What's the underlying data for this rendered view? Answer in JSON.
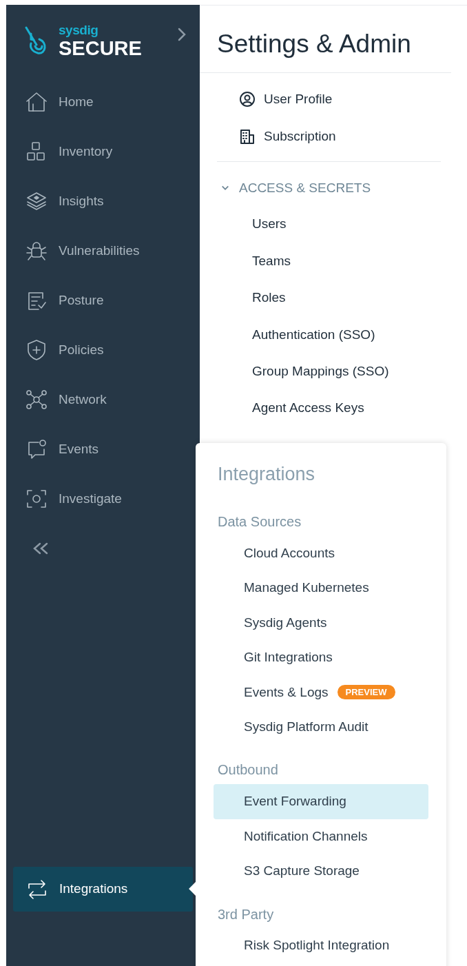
{
  "sidebar": {
    "logo": {
      "brand": "sysdig",
      "product": "SECURE"
    },
    "items": [
      {
        "label": "Home",
        "selected": false
      },
      {
        "label": "Inventory",
        "selected": false
      },
      {
        "label": "Insights",
        "selected": false
      },
      {
        "label": "Vulnerabilities",
        "selected": false
      },
      {
        "label": "Posture",
        "selected": false
      },
      {
        "label": "Policies",
        "selected": false
      },
      {
        "label": "Network",
        "selected": false
      },
      {
        "label": "Events",
        "selected": false
      },
      {
        "label": "Investigate",
        "selected": false
      }
    ],
    "bottom_items": [
      {
        "label": "Integrations",
        "selected": true
      }
    ]
  },
  "settings": {
    "title": "Settings & Admin",
    "items": [
      {
        "label": "User Profile"
      },
      {
        "label": "Subscription"
      }
    ],
    "sections": [
      {
        "title": "ACCESS & SECRETS",
        "expanded": true,
        "items": [
          {
            "label": "Users"
          },
          {
            "label": "Teams"
          },
          {
            "label": "Roles"
          },
          {
            "label": "Authentication (SSO)"
          },
          {
            "label": "Group Mappings (SSO)"
          },
          {
            "label": "Agent Access Keys"
          }
        ]
      }
    ]
  },
  "integrations_menu": {
    "title": "Integrations",
    "groups": [
      {
        "title": "Data Sources",
        "items": [
          {
            "label": "Cloud Accounts",
            "selected": false
          },
          {
            "label": "Managed Kubernetes",
            "selected": false
          },
          {
            "label": "Sysdig Agents",
            "selected": false
          },
          {
            "label": "Git Integrations",
            "selected": false
          },
          {
            "label": "Events & Logs",
            "selected": false,
            "badge": "PREVIEW"
          },
          {
            "label": "Sysdig Platform Audit",
            "selected": false
          }
        ]
      },
      {
        "title": "Outbound",
        "items": [
          {
            "label": "Event Forwarding",
            "selected": true
          },
          {
            "label": "Notification Channels",
            "selected": false
          },
          {
            "label": "S3 Capture Storage",
            "selected": false
          }
        ]
      },
      {
        "title": "3rd Party",
        "items": [
          {
            "label": "Risk Spotlight Integration",
            "selected": false
          }
        ]
      }
    ]
  }
}
